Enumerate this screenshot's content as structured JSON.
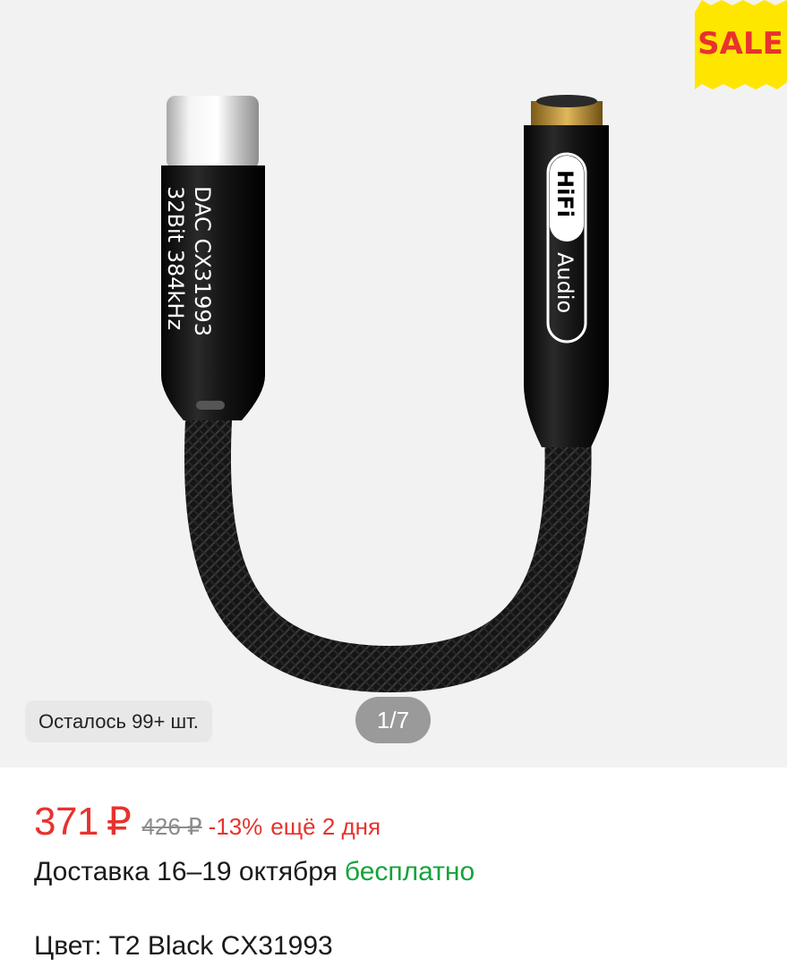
{
  "gallery": {
    "stock_label": "Осталось 99+ шт.",
    "page_counter": "1/7",
    "sale_badge": "SALE",
    "sale_badge_color": "#ffe600",
    "sale_text_color": "#e8322e",
    "product_plug_text_line1": "DAC CX31993",
    "product_plug_text_line2": "32Bit 384kHz",
    "product_jack_text_1": "HiFi",
    "product_jack_text_2": "Audio"
  },
  "price": {
    "current": "371",
    "currency": "₽",
    "old": "426 ₽",
    "discount": "-13%",
    "promo_note": "ещё 2 дня",
    "accent_color": "#e8322e"
  },
  "delivery": {
    "label": "Доставка 16–19 октября",
    "free_label": "бесплатно",
    "free_color": "#14a33b"
  },
  "variant": {
    "label": "Цвет:",
    "value": "T2 Black CX31993"
  }
}
